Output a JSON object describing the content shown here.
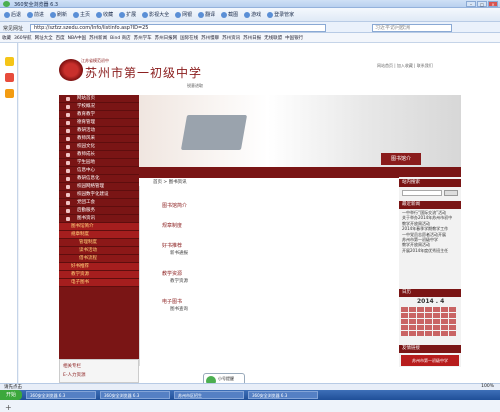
{
  "browser": {
    "title": "360安全浏览器 6.3",
    "toolbar": [
      "后退",
      "前进",
      "刷新",
      "主页",
      "收藏",
      "扩展",
      "影视大全",
      "网银",
      "翻译",
      "截图",
      "游戏",
      "登录管家"
    ],
    "address_label": "常见网址",
    "url": "http://szfzz.szedu.com/Info/listinfo.asp?ID=25",
    "search_placeholder": "习近平访问欧洲",
    "favorites": [
      "收藏",
      "360导航",
      "网址大全",
      "百度",
      "NBA中国",
      "苏州新闻",
      "Bind 商店",
      "苏州学车",
      "苏州日报网",
      "国际在线",
      "苏州慢聊",
      "苏州资讯",
      "苏州日报",
      "无线联盟",
      "中国银行"
    ]
  },
  "site": {
    "school_small": "江苏省模范初中",
    "school_name": "苏州市第一初级中学",
    "motto": "锐意进取",
    "top_links": "网站首页 | 加入收藏 | 联系我们",
    "banner_label": "图书馆介",
    "breadcrumb": "首页 > 图书资讯"
  },
  "nav": [
    "网站首页",
    "学校概况",
    "教育教学",
    "德育管理",
    "教研活动",
    "教师风采",
    "校园文化",
    "教师成长",
    "学生园地",
    "信息中心",
    "教研信息化",
    "校园网络管理",
    "校园数字化建设",
    "党团工会",
    "后勤服务",
    "图书资讯"
  ],
  "subnav": [
    "图书馆简介",
    "规章制度",
    "管理制度",
    "读书活动",
    "借书流程",
    "好书推荐",
    "教学资源",
    "电子图书"
  ],
  "footnav": [
    "相关专栏",
    "E-人力资源"
  ],
  "content": {
    "h1": "图书馆简介",
    "h2": "规章制度",
    "h3": "好书推荐",
    "l3": "新书通报",
    "h4": "教学资源",
    "l4": "教学资源",
    "h5": "电子图书",
    "l5": "图书查询"
  },
  "right": {
    "search_head": "站内搜索",
    "news_head": "最近新闻",
    "news": [
      "一中举行“国际交流”活动",
      "关于举办2014年苏州市初中",
      "教学开放周活动",
      "2014年春季学期教学工作",
      "一中党员志愿者活动开展",
      "苏州市第一初级中学",
      "教学开放周活动",
      "开展2014年度优秀班主任"
    ],
    "cal_head": "日历",
    "cal_title": "2014 . 4",
    "link_head": "友情链接",
    "link_banner": "苏州市第一初级中学"
  },
  "status": {
    "text": "请先点击",
    "zoom": "100%"
  },
  "taskbar": {
    "start": "开始",
    "tasks": [
      "360安全浏览器 6.3",
      "360安全浏览器 6.3",
      "苏州市区招生",
      "360安全浏览器 6.3"
    ],
    "toast": "小号提醒"
  }
}
